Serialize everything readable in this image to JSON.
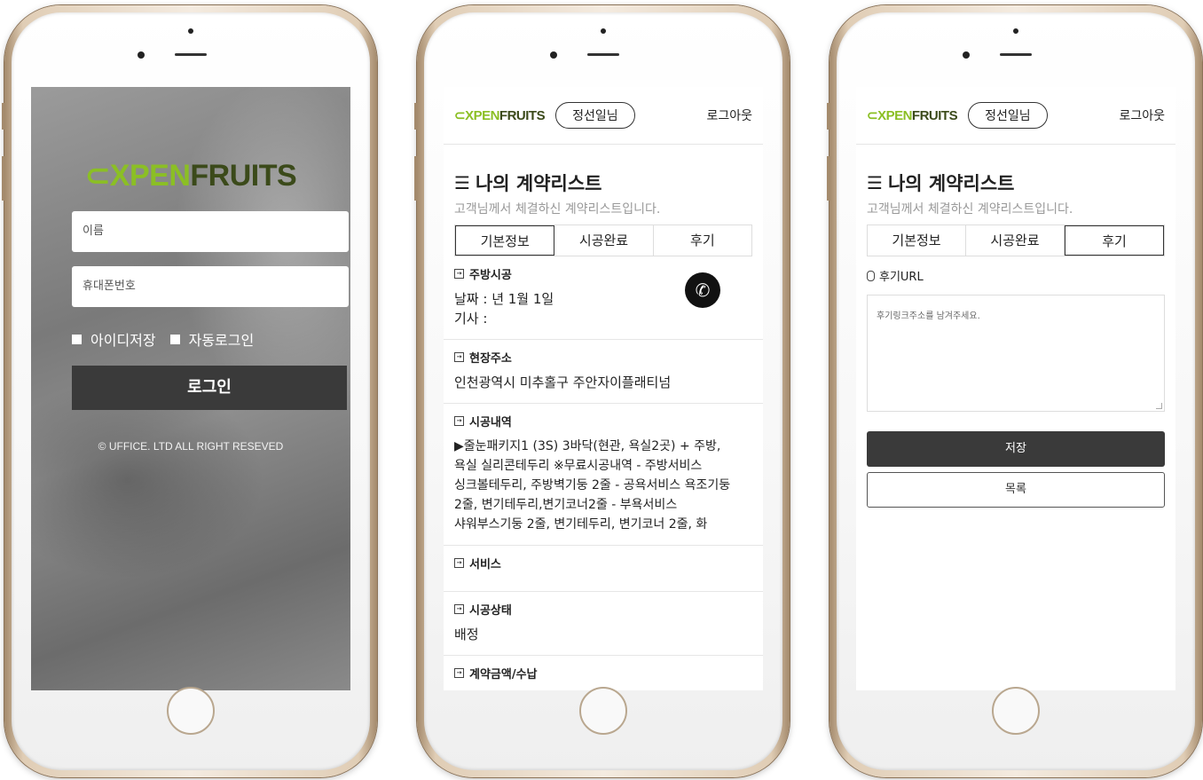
{
  "brand": {
    "logo_mark": "⊂X",
    "logo_open": "PEN",
    "logo_rest": "FRUITS"
  },
  "login": {
    "name_placeholder": "이름",
    "phone_placeholder": "휴대폰번호",
    "save_id_label": "아이디저장",
    "auto_login_label": "자동로그인",
    "login_button": "로그인",
    "copyright": "© UFFICE. LTD ALL RIGHT RESEVED"
  },
  "header": {
    "user_name": "정선일님",
    "logout": "로그아웃"
  },
  "contracts": {
    "title_icon": "☰",
    "title": "나의 계약리스트",
    "subtitle": "고객님께서 체결하신 계약리스트입니다.",
    "tabs": [
      "기본정보",
      "시공완료",
      "후기"
    ]
  },
  "detail": {
    "kitchen_title": "주방시공",
    "kitchen_date": "날짜 : 년 1월 1일",
    "kitchen_worker": "기사 :",
    "site_title": "현장주소",
    "site_address": "인천광역시 미추홀구 주안자이플래티넘",
    "work_title": "시공내역",
    "work_lines": [
      "▶줄눈패키지1 (3S) 3바닥(현관, 욕실2곳) + 주방,",
      "욕실 실리콘테두리 ※무료시공내역 - 주방서비스",
      "싱크볼테두리, 주방벽기둥 2줄 - 공욕서비스 욕조기둥",
      "2줄, 변기테두리,변기코너2줄 - 부욕서비스",
      "샤워부스기둥 2줄, 변기테두리, 변기코너 2줄, 화"
    ],
    "service_title": "서비스",
    "status_title": "시공상태",
    "status_value": "배정",
    "amount_title": "계약금액/수납"
  },
  "review": {
    "url_label": "후기URL",
    "placeholder": "후기링크주소를 남겨주세요.",
    "save_button": "저장",
    "list_button": "목록"
  },
  "colors": {
    "brand_green": "#8bbf24",
    "brand_dark": "#3b4a1a",
    "button_dark": "#3a3a3a"
  }
}
